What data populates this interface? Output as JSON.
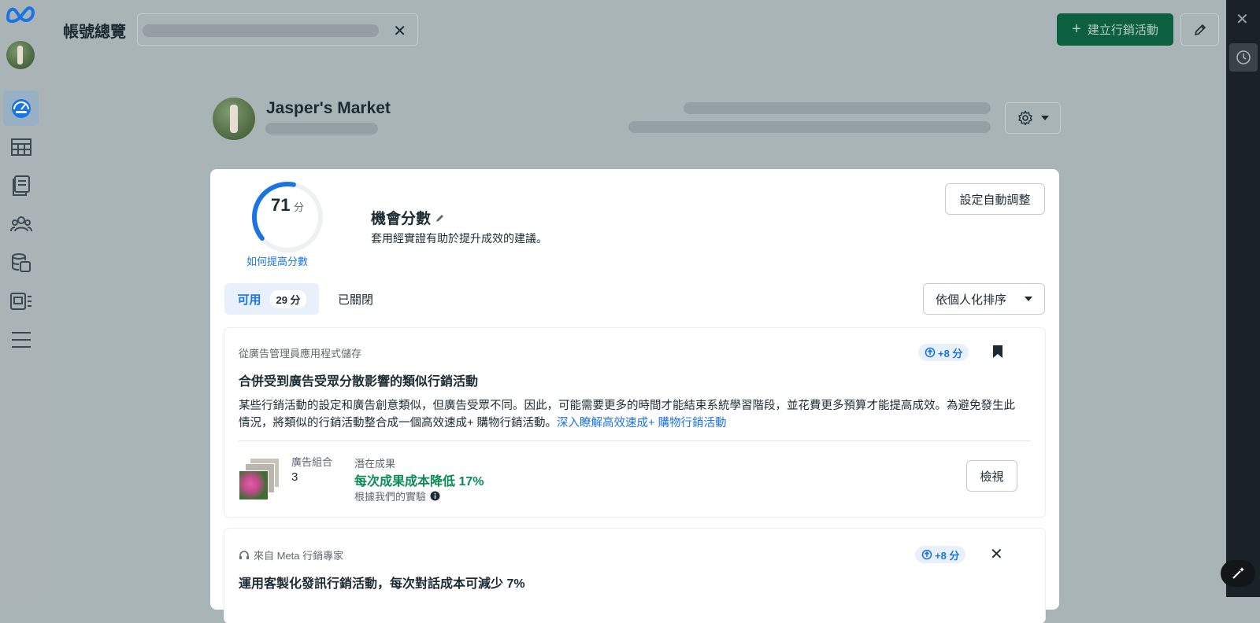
{
  "header": {
    "title": "帳號總覽",
    "create_label": "建立行銷活動"
  },
  "account": {
    "name": "Jasper's Market"
  },
  "opportunity": {
    "score": "71",
    "score_unit": "分",
    "score_fraction": 0.71,
    "how_to_improve": "如何提高分數",
    "title": "機會分數",
    "subtitle": "套用經實證有助於提升成效的建議。",
    "auto_adjust_label": "設定自動調整"
  },
  "tabs": {
    "available_label": "可用",
    "available_badge": "29 分",
    "closed_label": "已關閉"
  },
  "sort": {
    "label": "依個人化排序"
  },
  "recommendations": [
    {
      "source": "從廣告管理員應用程式儲存",
      "gain": "+8 分",
      "title": "合併受到廣告受眾分散影響的類似行銷活動",
      "body": "某些行銷活動的設定和廣告創意類似，但廣告受眾不同。因此，可能需要更多的時間才能結束系統學習階段，並花費更多預算才能提高成效。為避免發生此情況，將類似的行銷活動整合成一個高效速成+ 購物行銷活動。",
      "link": "深入瞭解高效速成+ 購物行銷活動",
      "adsets_label": "廣告組合",
      "adsets_value": "3",
      "potential_label": "潛在成果",
      "potential_value": "每次成果成本降低 17%",
      "experiment_note": "根據我們的實驗",
      "view_label": "檢視"
    },
    {
      "source": "來自 Meta 行銷專家",
      "gain": "+8 分",
      "title": "運用客製化發訊行銷活動，每次對話成本可減少 7%"
    }
  ],
  "colors": {
    "accent": "#1b74e4",
    "create_button": "#0c5f3f",
    "positive": "#0a8a55"
  }
}
